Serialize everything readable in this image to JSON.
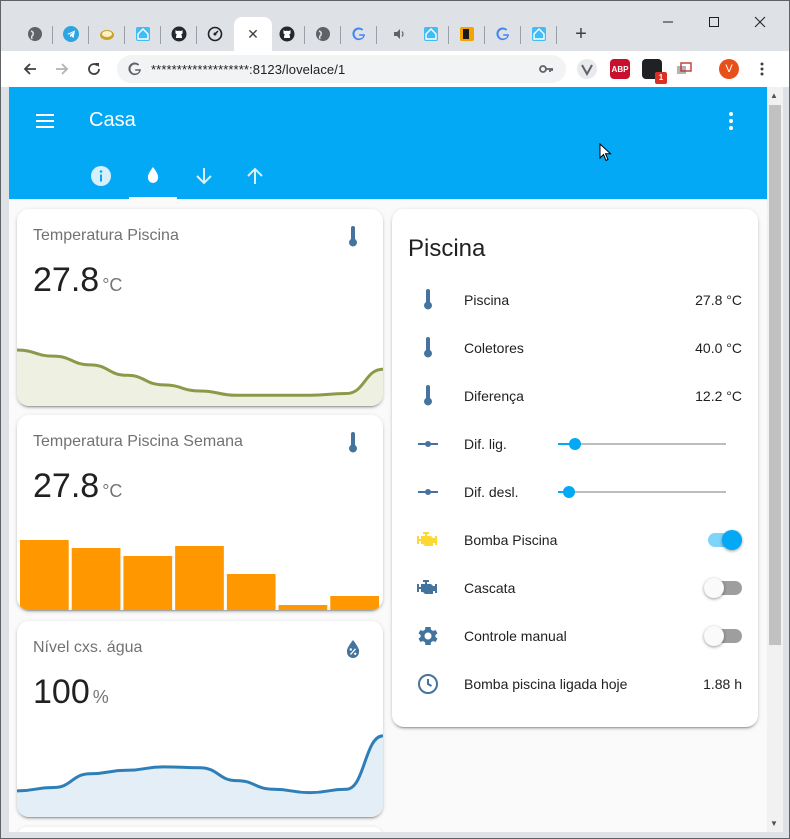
{
  "browser": {
    "active_tab_close": "✕",
    "new_tab": "+",
    "url": "*******************:8123/lovelace/1",
    "profile_initial": "V",
    "abp_label": "ABP",
    "ext_badge": "1"
  },
  "ha": {
    "title": "Casa",
    "tabs": [
      "info",
      "water",
      "arrow-down",
      "arrow-up"
    ],
    "active_tab": 1,
    "accent": "#03a9f4"
  },
  "cards": {
    "temp_pool": {
      "name": "Temperatura Piscina",
      "value": "27.8",
      "unit": "°C"
    },
    "temp_week": {
      "name": "Temperatura Piscina Semana",
      "value": "27.8",
      "unit": "°C"
    },
    "water_level": {
      "name": "Nível cxs. água",
      "value": "100",
      "unit": "%"
    }
  },
  "entities": {
    "title": "Piscina",
    "rows": {
      "piscina": {
        "name": "Piscina",
        "state": "27.8 °C"
      },
      "coletores": {
        "name": "Coletores",
        "state": "40.0 °C"
      },
      "diferenca": {
        "name": "Diferença",
        "state": "12.2 °C"
      },
      "dif_lig": {
        "name": "Dif. lig.",
        "value_fraction": 0.1
      },
      "dif_desl": {
        "name": "Dif. desl.",
        "value_fraction": 0.065
      },
      "bomba": {
        "name": "Bomba Piscina",
        "on": true
      },
      "cascata": {
        "name": "Cascata",
        "on": false
      },
      "controle": {
        "name": "Controle manual",
        "on": false
      },
      "ligada_hoje": {
        "name": "Bomba piscina ligada hoje",
        "state": "1.88 h"
      }
    }
  },
  "chart_data": [
    {
      "type": "area",
      "series": [
        {
          "values": [
            0.62,
            0.55,
            0.45,
            0.33,
            0.22,
            0.15,
            0.1,
            0.1,
            0.1,
            0.12,
            0.4
          ]
        }
      ],
      "color": "#8a9a4a"
    },
    {
      "type": "bar",
      "series": [
        {
          "values": [
            70,
            62,
            54,
            64,
            36,
            5,
            14
          ]
        }
      ],
      "color": "#ff9800"
    },
    {
      "type": "area",
      "series": [
        {
          "values": [
            0.28,
            0.32,
            0.48,
            0.52,
            0.56,
            0.55,
            0.4,
            0.3,
            0.26,
            0.3,
            0.92
          ]
        }
      ],
      "color": "#2e7fb8"
    }
  ]
}
